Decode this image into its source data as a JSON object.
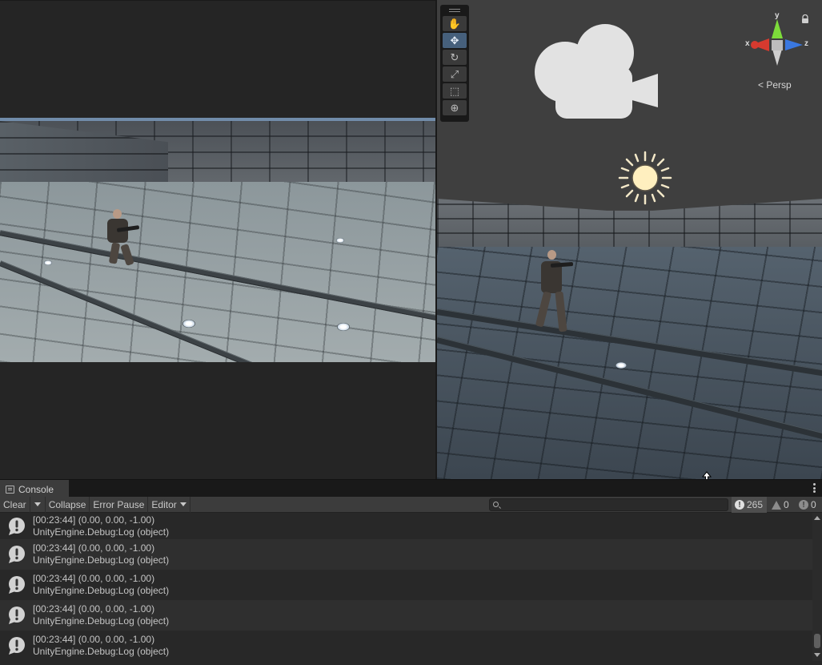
{
  "scene_view": {
    "tools": [
      {
        "name": "hand-tool",
        "glyph": "✋"
      },
      {
        "name": "move-tool",
        "glyph": "✥"
      },
      {
        "name": "rotate-tool",
        "glyph": "↻"
      },
      {
        "name": "scale-tool",
        "glyph": "⤢"
      },
      {
        "name": "rect-tool",
        "glyph": "⬚"
      },
      {
        "name": "transform-tool",
        "glyph": "⊕"
      }
    ],
    "active_tool": "move-tool",
    "gizmo": {
      "x_label": "x",
      "y_label": "y",
      "z_label": "z",
      "x_color": "#d63a2f",
      "y_color": "#7ddc3a",
      "z_color": "#3a78e0"
    },
    "projection_label": "Persp"
  },
  "console": {
    "tab_label": "Console",
    "toolbar": {
      "clear_label": "Clear",
      "collapse_label": "Collapse",
      "error_pause_label": "Error Pause",
      "editor_label": "Editor",
      "search_placeholder": ""
    },
    "counts": {
      "log": "265",
      "warning": "0",
      "error": "0"
    },
    "entries": [
      {
        "line1": "[00:23:44] (0.00, 0.00, -1.00)",
        "line2": "UnityEngine.Debug:Log (object)"
      },
      {
        "line1": "[00:23:44] (0.00, 0.00, -1.00)",
        "line2": "UnityEngine.Debug:Log (object)"
      },
      {
        "line1": "[00:23:44] (0.00, 0.00, -1.00)",
        "line2": "UnityEngine.Debug:Log (object)"
      },
      {
        "line1": "[00:23:44] (0.00, 0.00, -1.00)",
        "line2": "UnityEngine.Debug:Log (object)"
      },
      {
        "line1": "[00:23:44] (0.00, 0.00, -1.00)",
        "line2": "UnityEngine.Debug:Log (object)"
      }
    ]
  },
  "colors": {
    "active_tool": "#46607c",
    "panel_bg": "#282828",
    "toolbar_bg": "#3c3c3c"
  }
}
